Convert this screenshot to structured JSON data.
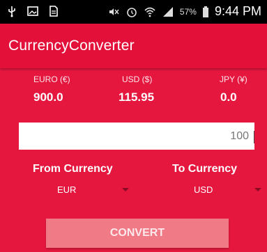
{
  "statusbar": {
    "icons_left": [
      "usb-icon",
      "image-icon",
      "document-icon"
    ],
    "icons_right": [
      "mute-icon",
      "alarm-icon",
      "wifi-icon",
      "signal-icon",
      "battery-icon"
    ],
    "battery_percent": "57%",
    "time": "9:44 PM"
  },
  "appbar": {
    "title": "CurrencyConverter"
  },
  "results": [
    {
      "label": "EURO (€)",
      "value": "900.0"
    },
    {
      "label": "USD ($)",
      "value": "115.95"
    },
    {
      "label": "JPY (¥)",
      "value": "0.0"
    }
  ],
  "amount": {
    "value": "100"
  },
  "from": {
    "label": "From Currency",
    "selected": "EUR"
  },
  "to": {
    "label": "To Currency",
    "selected": "USD"
  },
  "convert_label": "CONVERT",
  "colors": {
    "background": "#e5173f",
    "appbar": "#e3103a",
    "button": "#f07a86",
    "statusbar": "#000000"
  }
}
